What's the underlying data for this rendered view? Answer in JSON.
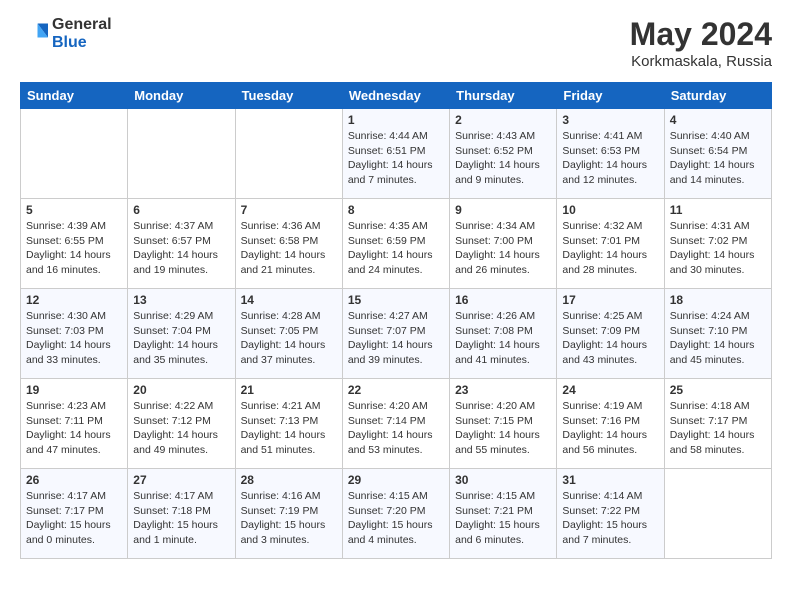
{
  "logo": {
    "general": "General",
    "blue": "Blue"
  },
  "title": "May 2024",
  "subtitle": "Korkmaskala, Russia",
  "weekdays": [
    "Sunday",
    "Monday",
    "Tuesday",
    "Wednesday",
    "Thursday",
    "Friday",
    "Saturday"
  ],
  "weeks": [
    [
      {
        "day": "",
        "info": ""
      },
      {
        "day": "",
        "info": ""
      },
      {
        "day": "",
        "info": ""
      },
      {
        "day": "1",
        "info": "Sunrise: 4:44 AM\nSunset: 6:51 PM\nDaylight: 14 hours\nand 7 minutes."
      },
      {
        "day": "2",
        "info": "Sunrise: 4:43 AM\nSunset: 6:52 PM\nDaylight: 14 hours\nand 9 minutes."
      },
      {
        "day": "3",
        "info": "Sunrise: 4:41 AM\nSunset: 6:53 PM\nDaylight: 14 hours\nand 12 minutes."
      },
      {
        "day": "4",
        "info": "Sunrise: 4:40 AM\nSunset: 6:54 PM\nDaylight: 14 hours\nand 14 minutes."
      }
    ],
    [
      {
        "day": "5",
        "info": "Sunrise: 4:39 AM\nSunset: 6:55 PM\nDaylight: 14 hours\nand 16 minutes."
      },
      {
        "day": "6",
        "info": "Sunrise: 4:37 AM\nSunset: 6:57 PM\nDaylight: 14 hours\nand 19 minutes."
      },
      {
        "day": "7",
        "info": "Sunrise: 4:36 AM\nSunset: 6:58 PM\nDaylight: 14 hours\nand 21 minutes."
      },
      {
        "day": "8",
        "info": "Sunrise: 4:35 AM\nSunset: 6:59 PM\nDaylight: 14 hours\nand 24 minutes."
      },
      {
        "day": "9",
        "info": "Sunrise: 4:34 AM\nSunset: 7:00 PM\nDaylight: 14 hours\nand 26 minutes."
      },
      {
        "day": "10",
        "info": "Sunrise: 4:32 AM\nSunset: 7:01 PM\nDaylight: 14 hours\nand 28 minutes."
      },
      {
        "day": "11",
        "info": "Sunrise: 4:31 AM\nSunset: 7:02 PM\nDaylight: 14 hours\nand 30 minutes."
      }
    ],
    [
      {
        "day": "12",
        "info": "Sunrise: 4:30 AM\nSunset: 7:03 PM\nDaylight: 14 hours\nand 33 minutes."
      },
      {
        "day": "13",
        "info": "Sunrise: 4:29 AM\nSunset: 7:04 PM\nDaylight: 14 hours\nand 35 minutes."
      },
      {
        "day": "14",
        "info": "Sunrise: 4:28 AM\nSunset: 7:05 PM\nDaylight: 14 hours\nand 37 minutes."
      },
      {
        "day": "15",
        "info": "Sunrise: 4:27 AM\nSunset: 7:07 PM\nDaylight: 14 hours\nand 39 minutes."
      },
      {
        "day": "16",
        "info": "Sunrise: 4:26 AM\nSunset: 7:08 PM\nDaylight: 14 hours\nand 41 minutes."
      },
      {
        "day": "17",
        "info": "Sunrise: 4:25 AM\nSunset: 7:09 PM\nDaylight: 14 hours\nand 43 minutes."
      },
      {
        "day": "18",
        "info": "Sunrise: 4:24 AM\nSunset: 7:10 PM\nDaylight: 14 hours\nand 45 minutes."
      }
    ],
    [
      {
        "day": "19",
        "info": "Sunrise: 4:23 AM\nSunset: 7:11 PM\nDaylight: 14 hours\nand 47 minutes."
      },
      {
        "day": "20",
        "info": "Sunrise: 4:22 AM\nSunset: 7:12 PM\nDaylight: 14 hours\nand 49 minutes."
      },
      {
        "day": "21",
        "info": "Sunrise: 4:21 AM\nSunset: 7:13 PM\nDaylight: 14 hours\nand 51 minutes."
      },
      {
        "day": "22",
        "info": "Sunrise: 4:20 AM\nSunset: 7:14 PM\nDaylight: 14 hours\nand 53 minutes."
      },
      {
        "day": "23",
        "info": "Sunrise: 4:20 AM\nSunset: 7:15 PM\nDaylight: 14 hours\nand 55 minutes."
      },
      {
        "day": "24",
        "info": "Sunrise: 4:19 AM\nSunset: 7:16 PM\nDaylight: 14 hours\nand 56 minutes."
      },
      {
        "day": "25",
        "info": "Sunrise: 4:18 AM\nSunset: 7:17 PM\nDaylight: 14 hours\nand 58 minutes."
      }
    ],
    [
      {
        "day": "26",
        "info": "Sunrise: 4:17 AM\nSunset: 7:17 PM\nDaylight: 15 hours\nand 0 minutes."
      },
      {
        "day": "27",
        "info": "Sunrise: 4:17 AM\nSunset: 7:18 PM\nDaylight: 15 hours\nand 1 minute."
      },
      {
        "day": "28",
        "info": "Sunrise: 4:16 AM\nSunset: 7:19 PM\nDaylight: 15 hours\nand 3 minutes."
      },
      {
        "day": "29",
        "info": "Sunrise: 4:15 AM\nSunset: 7:20 PM\nDaylight: 15 hours\nand 4 minutes."
      },
      {
        "day": "30",
        "info": "Sunrise: 4:15 AM\nSunset: 7:21 PM\nDaylight: 15 hours\nand 6 minutes."
      },
      {
        "day": "31",
        "info": "Sunrise: 4:14 AM\nSunset: 7:22 PM\nDaylight: 15 hours\nand 7 minutes."
      },
      {
        "day": "",
        "info": ""
      }
    ]
  ]
}
